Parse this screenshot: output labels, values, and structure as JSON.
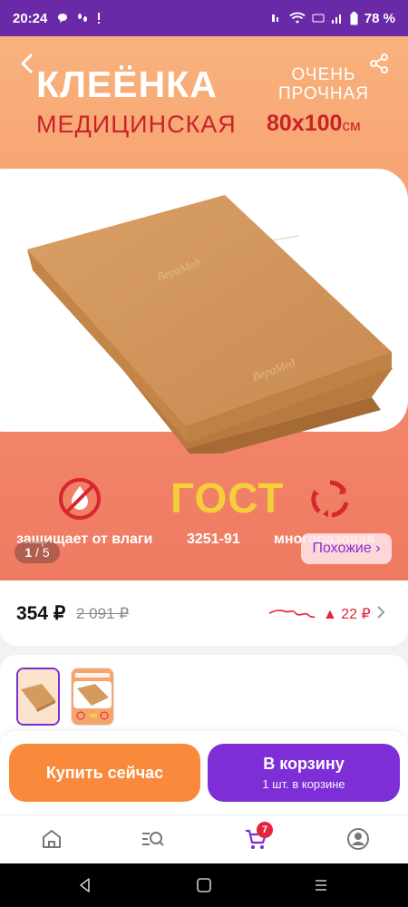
{
  "status_bar": {
    "time": "20:24",
    "battery": "78 %",
    "icons": [
      "chat-icon",
      "steps-icon",
      "alarm-icon",
      "wifi-icon",
      "volte-icon",
      "signal-icon",
      "battery-icon"
    ]
  },
  "hero": {
    "title": "КЛЕЁНКА",
    "subtitle": "МЕДИЦИНСКАЯ",
    "strong_text": "ОЧЕНЬ ПРОЧНАЯ",
    "size_value": "80х100",
    "size_unit": "см",
    "features": {
      "moisture": "защищает от влаги",
      "gost_logo": "ГОСТ",
      "gost": "3251-91",
      "reusable": "многоразовая"
    },
    "image_counter_current": "1",
    "image_counter_total": "/ 5",
    "similar_label": "Похожие ›"
  },
  "price": {
    "current": "354 ₽",
    "old": "2 091 ₽",
    "change": "▲ 22 ₽"
  },
  "actions": {
    "buy_now": "Купить сейчас",
    "add_to_cart": "В корзину",
    "cart_note": "1 шт. в корзине"
  },
  "bottom_nav": {
    "cart_badge": "7"
  },
  "colors": {
    "status_bar": "#6a2aa8",
    "accent_purple": "#7d2ed6",
    "accent_orange": "#f98a3c",
    "price_up": "#e2233b"
  }
}
